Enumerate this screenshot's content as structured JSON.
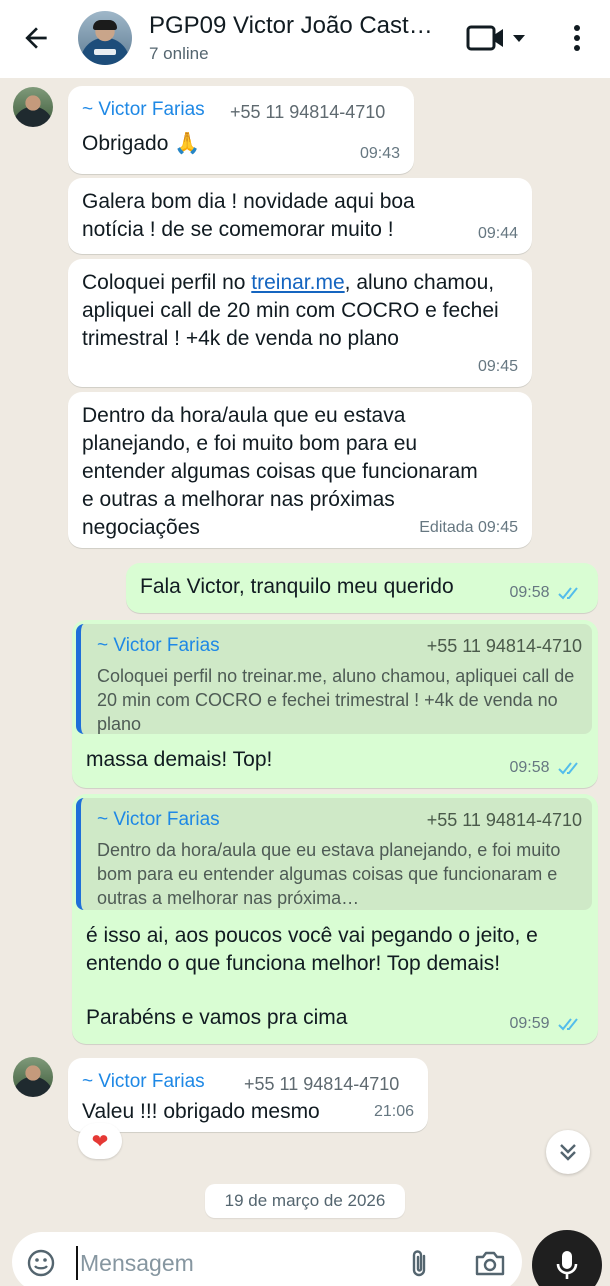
{
  "header": {
    "title": "PGP09 Victor João Cast…",
    "subtitle": "7 online"
  },
  "messages": [
    {
      "sender": "~ Victor Farias",
      "phone": "+55 11 94814-4710",
      "text": "Obrigado 🙏",
      "time": "09:43"
    },
    {
      "text": "Galera bom dia ! novidade aqui boa notícia ! de se comemorar muito !",
      "time": "09:44"
    },
    {
      "text_before": "Coloquei perfil no ",
      "link": "treinar.me",
      "text_after": ", aluno chamou, apliquei call de 20 min com COCRO e fechei trimestral ! +4k de venda no plano",
      "time": "09:45"
    },
    {
      "text": "Dentro da hora/aula que eu estava planejando, e foi muito bom para eu entender algumas coisas que funcionaram e outras a melhorar nas próximas negociações",
      "time": "Editada 09:45"
    },
    {
      "text": "Fala Victor, tranquilo meu querido",
      "time": "09:58"
    },
    {
      "quote": {
        "sender": "~ Victor Farias",
        "phone": "+55 11 94814-4710",
        "text": "Coloquei perfil no treinar.me, aluno chamou, apliquei call de 20 min com COCRO e fechei trimestral ! +4k de venda no plano"
      },
      "text": "massa demais! Top!",
      "time": "09:58"
    },
    {
      "quote": {
        "sender": "~ Victor Farias",
        "phone": "+55 11 94814-4710",
        "text": "Dentro da hora/aula que eu estava planejando, e foi muito bom para eu entender algumas coisas que funcionaram e outras a melhorar nas próxima…"
      },
      "text1": "é isso ai, aos poucos você vai pegando o jeito, e entendo o que funciona melhor! Top demais!",
      "text2": "Parabéns e vamos pra cima",
      "time": "09:59"
    },
    {
      "sender": "~ Victor Farias",
      "phone": "+55 11 94814-4710",
      "text": "Valeu !!! obrigado mesmo",
      "time": "21:06",
      "reaction": "❤"
    }
  ],
  "date_separator": "19 de março de 2026",
  "input": {
    "placeholder": "Mensagem"
  },
  "colors": {
    "outgoing_bubble": "#d9fdd3",
    "incoming_bubble": "#ffffff",
    "read_ticks": "#53bdeb",
    "sender_name": "#1e88e5"
  },
  "icons": [
    "back-arrow-icon",
    "video-call-icon",
    "chevron-down-icon",
    "more-vert-icon",
    "double-check-icon",
    "emoji-icon",
    "attach-icon",
    "camera-icon",
    "mic-icon"
  ]
}
